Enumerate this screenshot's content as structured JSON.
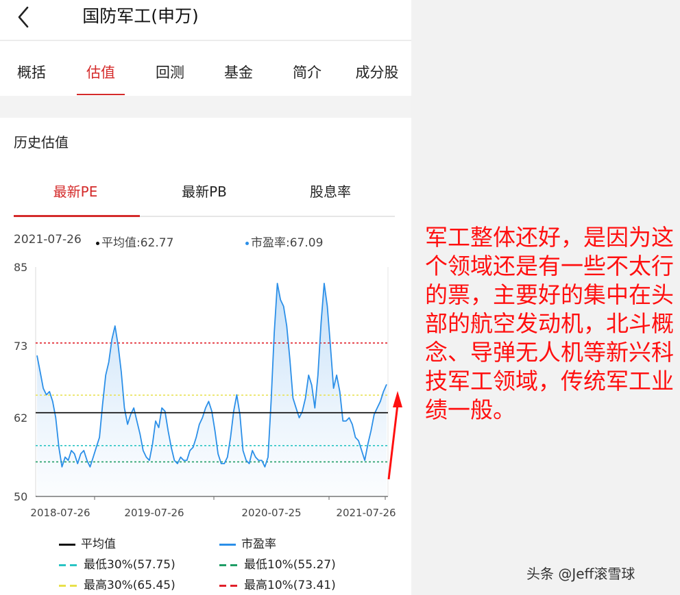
{
  "header": {
    "title": "国防军工(申万)"
  },
  "tabs": [
    "概括",
    "估值",
    "回测",
    "基金",
    "简介",
    "成分股"
  ],
  "active_tab": "估值",
  "section": {
    "title": "历史估值"
  },
  "subtabs": [
    "最新PE",
    "最新PB",
    "股息率"
  ],
  "active_subtab": "最新PE",
  "info": {
    "date": "2021-07-26",
    "avg": "平均值:62.77",
    "pe": "市盈率:67.09"
  },
  "colors": {
    "accent": "#d42a2a",
    "pe_line": "#2b8fe8",
    "avg_line": "#111111",
    "low30": "#29c4c4",
    "low10": "#1f9d66",
    "high30": "#e8e04a",
    "high10": "#e0202a",
    "annotation": "#ff1010"
  },
  "chart_data": {
    "type": "line",
    "x_ticks": [
      "2018-07-26",
      "2019-07-26",
      "2020-07-25",
      "2021-07-26"
    ],
    "y_ticks": [
      "85",
      "73",
      "62",
      "50"
    ],
    "ylim": [
      50,
      85
    ],
    "series": [
      {
        "name": "市盈率",
        "values": [
          71.5,
          69.0,
          66.5,
          65.5,
          66.0,
          64.5,
          62.0,
          57.5,
          54.5,
          56.0,
          55.5,
          57.0,
          56.5,
          55.0,
          56.5,
          57.0,
          55.5,
          54.5,
          56.0,
          57.5,
          59.0,
          64.0,
          68.5,
          70.5,
          74.0,
          76.0,
          73.0,
          69.0,
          63.5,
          61.0,
          62.5,
          63.5,
          61.5,
          59.5,
          57.0,
          56.0,
          55.5,
          58.0,
          61.5,
          60.5,
          63.5,
          63.0,
          60.0,
          57.5,
          55.5,
          55.0,
          56.0,
          55.5,
          55.5,
          57.0,
          57.5,
          59.0,
          61.0,
          62.0,
          63.5,
          64.5,
          63.0,
          60.0,
          56.5,
          55.0,
          55.0,
          56.0,
          59.0,
          63.0,
          65.5,
          62.5,
          57.0,
          55.5,
          55.0,
          57.0,
          56.0,
          55.5,
          55.5,
          54.5,
          56.0,
          64.5,
          75.0,
          82.5,
          80.0,
          79.0,
          76.0,
          71.0,
          65.0,
          63.5,
          62.0,
          63.0,
          65.0,
          68.5,
          67.0,
          63.5,
          68.5,
          76.5,
          82.5,
          79.0,
          73.0,
          66.5,
          68.5,
          66.0,
          61.5,
          61.5,
          62.0,
          61.0,
          59.0,
          58.5,
          57.0,
          55.5,
          58.0,
          60.0,
          62.5,
          63.5,
          64.5,
          66.0,
          67.09
        ]
      }
    ],
    "avg": 62.77,
    "bands": {
      "low30": 57.75,
      "low10": 55.27,
      "high30": 65.45,
      "high10": 73.41
    }
  },
  "legend": [
    {
      "key": "avg",
      "label": "平均值",
      "style": "solid-black"
    },
    {
      "key": "pe",
      "label": "市盈率",
      "style": "solid-blue"
    },
    {
      "key": "low30",
      "label": "最低30%(57.75)",
      "style": "dash-cyan"
    },
    {
      "key": "low10",
      "label": "最低10%(55.27)",
      "style": "dash-green"
    },
    {
      "key": "high30",
      "label": "最高30%(65.45)",
      "style": "dash-yellow"
    },
    {
      "key": "high10",
      "label": "最高10%(73.41)",
      "style": "dash-red"
    }
  ],
  "annotation": {
    "text": "军工整体还好，是因为这个领域还是有一些不太行的票，主要好的集中在头部的航空发动机，北斗概念、导弹无人机等新兴科技军工领域，传统军工业绩一般。"
  },
  "watermark": "头条 @Jeff滚雪球"
}
